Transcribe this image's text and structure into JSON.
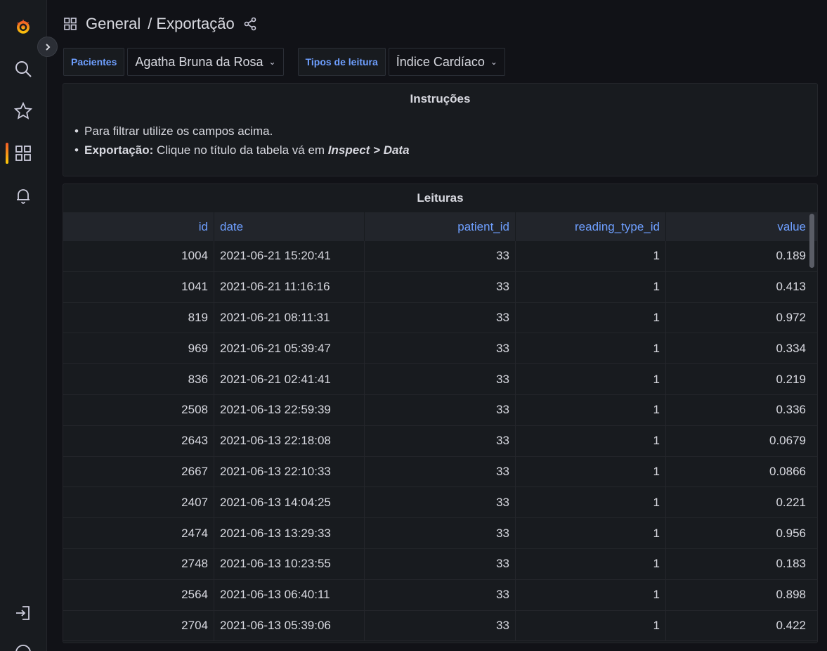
{
  "header": {
    "folder": "General",
    "separator": "/",
    "title": "Exportação"
  },
  "variables": [
    {
      "label": "Pacientes",
      "value": "Agatha Bruna da Rosa"
    },
    {
      "label": "Tipos de leitura",
      "value": "Índice Cardíaco"
    }
  ],
  "instructions": {
    "title": "Instruções",
    "item1": "Para filtrar utilize os campos acima.",
    "item2_bold": "Exportação:",
    "item2_text": " Clique no título da tabela vá em ",
    "item2_italic": "Inspect > Data"
  },
  "table": {
    "title": "Leituras",
    "columns": [
      "id",
      "date",
      "patient_id",
      "reading_type_id",
      "value"
    ],
    "rows": [
      [
        "1004",
        "2021-06-21 15:20:41",
        "33",
        "1",
        "0.189"
      ],
      [
        "1041",
        "2021-06-21 11:16:16",
        "33",
        "1",
        "0.413"
      ],
      [
        "819",
        "2021-06-21 08:11:31",
        "33",
        "1",
        "0.972"
      ],
      [
        "969",
        "2021-06-21 05:39:47",
        "33",
        "1",
        "0.334"
      ],
      [
        "836",
        "2021-06-21 02:41:41",
        "33",
        "1",
        "0.219"
      ],
      [
        "2508",
        "2021-06-13 22:59:39",
        "33",
        "1",
        "0.336"
      ],
      [
        "2643",
        "2021-06-13 22:18:08",
        "33",
        "1",
        "0.0679"
      ],
      [
        "2667",
        "2021-06-13 22:10:33",
        "33",
        "1",
        "0.0866"
      ],
      [
        "2407",
        "2021-06-13 14:04:25",
        "33",
        "1",
        "0.221"
      ],
      [
        "2474",
        "2021-06-13 13:29:33",
        "33",
        "1",
        "0.956"
      ],
      [
        "2748",
        "2021-06-13 10:23:55",
        "33",
        "1",
        "0.183"
      ],
      [
        "2564",
        "2021-06-13 06:40:11",
        "33",
        "1",
        "0.898"
      ],
      [
        "2704",
        "2021-06-13 05:39:06",
        "33",
        "1",
        "0.422"
      ]
    ]
  },
  "sidebar": {
    "icons": [
      "grafana-logo-icon",
      "search-icon",
      "star-icon",
      "dashboards-icon",
      "bell-icon",
      "sign-in-icon",
      "help-icon"
    ]
  },
  "colors": {
    "accent_blue": "#6e9fff",
    "background": "#111217",
    "panel": "#181b1f"
  }
}
